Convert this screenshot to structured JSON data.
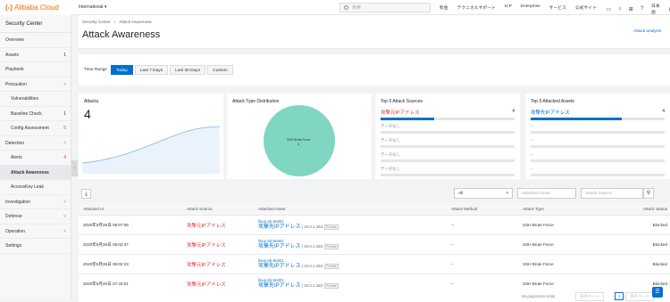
{
  "topbar": {
    "logo_mark": "(-)",
    "logo_text": "Alibaba Cloud",
    "region": "International",
    "search_placeholder": "検索",
    "nav": [
      "料金",
      "テクニカルサポート",
      "ICP",
      "Enterprise",
      "サービス",
      "公式サイト"
    ],
    "lang": "日本語"
  },
  "sidebar": {
    "title": "Security Center",
    "items": [
      {
        "label": "Overview",
        "sub": false,
        "count": "",
        "chev": ""
      },
      {
        "label": "Assets",
        "sub": false,
        "count": "1",
        "chev": ""
      },
      {
        "label": "Playbook",
        "sub": false,
        "count": "",
        "chev": ""
      },
      {
        "label": "Precaution",
        "sub": false,
        "count": "",
        "chev": "^"
      },
      {
        "label": "Vulnerabilities",
        "sub": true,
        "count": "",
        "chev": ""
      },
      {
        "label": "Baseline Check",
        "sub": true,
        "count": "1",
        "chev": ""
      },
      {
        "label": "Config Assessment",
        "sub": true,
        "count": "5",
        "chev": "",
        "red": true
      },
      {
        "label": "Detection",
        "sub": false,
        "count": "",
        "chev": "^"
      },
      {
        "label": "Alerts",
        "sub": true,
        "count": "4",
        "chev": "",
        "red": true
      },
      {
        "label": "Attack Awareness",
        "sub": true,
        "count": "",
        "chev": "",
        "active": true
      },
      {
        "label": "AccessKey Leak",
        "sub": true,
        "count": "",
        "chev": ""
      },
      {
        "label": "Investigation",
        "sub": false,
        "count": "",
        "chev": "v"
      },
      {
        "label": "Defense",
        "sub": false,
        "count": "",
        "chev": "v"
      },
      {
        "label": "Operation",
        "sub": false,
        "count": "",
        "chev": "v"
      },
      {
        "label": "Settings",
        "sub": false,
        "count": "",
        "chev": ""
      }
    ]
  },
  "header": {
    "crumb1": "Security Center",
    "crumb_sep": "/",
    "crumb2": "Attack Awareness",
    "title": "Attack Awareness",
    "analysis_link": "Attack analysis"
  },
  "time_range": {
    "label": "Time Range",
    "options": [
      "Today",
      "Last 7 Days",
      "Last 30 Days",
      "Custom"
    ],
    "selected": "Today"
  },
  "cards": {
    "attacks_title": "Attacks",
    "attacks_value": "4",
    "distribution_title": "Attack Type Distribution",
    "pie_label": "SSH Brute Force",
    "pie_value": "4",
    "sources_title": "Top 5 Attack Sources",
    "source_top": "攻撃元IPアドレス",
    "source_top_count": "4",
    "assets_title": "Top 5 Attacked Assets",
    "asset_top": "攻撃先IPアドレス",
    "asset_top_count": "4",
    "no_data": "データなし",
    "dash": "--"
  },
  "filters": {
    "select_value": "All",
    "attacked_asset_placeholder": "Attacked Asset",
    "attack_source_placeholder": "Attack Source"
  },
  "table": {
    "headers": [
      "Attacked At",
      "Attack Source",
      "Attacked Asset",
      "Attack Method",
      "Attack Type",
      "Attack Status"
    ],
    "rows": [
      {
        "time": "2020年5月26日 08:07:06",
        "source": "攻撃元IPアドレス",
        "asset_name": "linux-sb-test01",
        "asset_ip": "攻撃先IPアドレス",
        "private_ip": "10.0.1.163",
        "tag": "Private",
        "method": "--",
        "type": "SSH Brute Force",
        "status": "Blocked"
      },
      {
        "time": "2020年5月26日 08:02:37",
        "source": "攻撃元IPアドレス",
        "asset_name": "linux-sb-test01",
        "asset_ip": "攻撃先IPアドレス",
        "private_ip": "10.0.1.163",
        "tag": "Private",
        "method": "--",
        "type": "SSH Brute Force",
        "status": "Blocked"
      },
      {
        "time": "2020年5月26日 08:02:23",
        "source": "攻撃元IPアドレス",
        "asset_name": "linux-sb-test01",
        "asset_ip": "攻撃先IPアドレス",
        "private_ip": "10.0.1.163",
        "tag": "Private",
        "method": "--",
        "type": "SSH Brute Force",
        "status": "Blocked"
      },
      {
        "time": "2020年5月26日 07:43:51",
        "source": "攻撃元IPアドレス",
        "asset_name": "linux-sb-test01",
        "asset_ip": "攻撃先IPアドレス",
        "private_ip": "10.0.1.163",
        "tag": "Private",
        "method": "--",
        "type": "SSH Brute Force",
        "status": "Blocked"
      }
    ]
  },
  "pagination": {
    "total": "sky.pagination.total",
    "prev": "前のページ",
    "page": "1",
    "next": "次のページ"
  },
  "colors": {
    "accent": "#0070cc",
    "brand": "#ff6a00",
    "danger": "#e62e2e",
    "pie": "#7fd6c2"
  }
}
